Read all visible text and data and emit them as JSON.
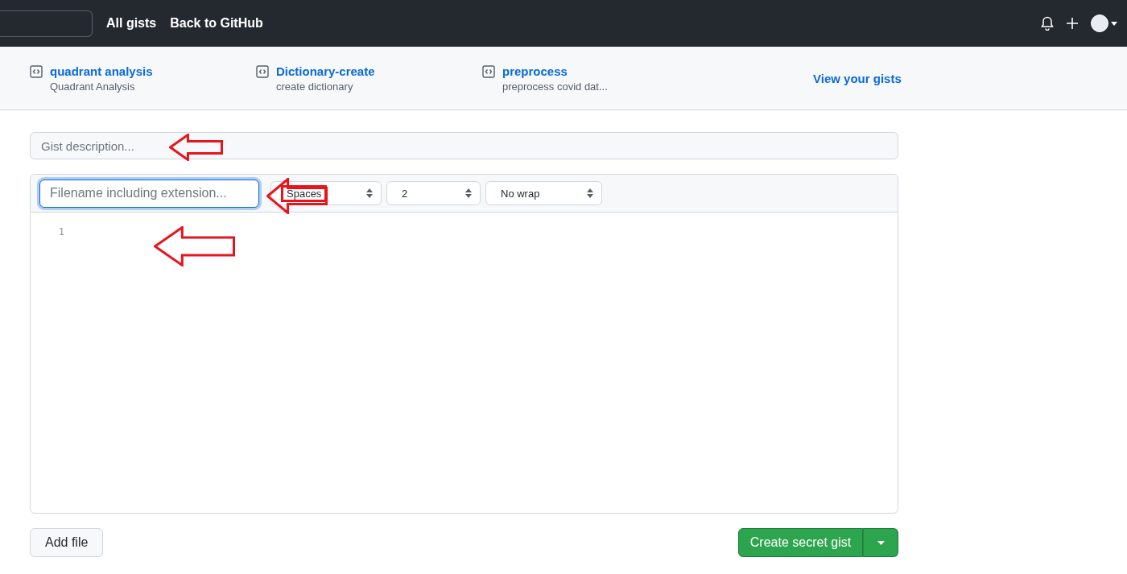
{
  "header": {
    "nav": [
      "All gists",
      "Back to GitHub"
    ]
  },
  "pinned_gists": [
    {
      "title": "quadrant analysis",
      "description": "Quadrant Analysis"
    },
    {
      "title": "Dictionary-create",
      "description": "create dictionary"
    },
    {
      "title": "preprocess",
      "description": "preprocess covid dat..."
    }
  ],
  "view_link": "View your gists",
  "description_field": {
    "placeholder": "Gist description..."
  },
  "file": {
    "filename_field": {
      "placeholder": "Filename including extension...",
      "focused": true
    },
    "selects": [
      "Spaces",
      "2",
      "No wrap"
    ],
    "line_numbers": [
      "1"
    ]
  },
  "buttons": {
    "add_file": "Add file",
    "create": "Create secret gist"
  }
}
